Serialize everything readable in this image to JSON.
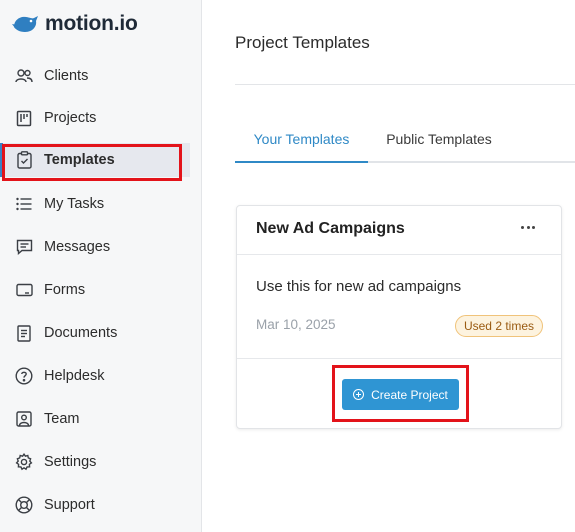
{
  "brand": {
    "name": "motion.io"
  },
  "sidebar": {
    "items": [
      {
        "label": "Clients",
        "icon": "clients-icon"
      },
      {
        "label": "Projects",
        "icon": "projects-icon"
      },
      {
        "label": "Templates",
        "icon": "templates-icon",
        "active": true
      },
      {
        "label": "My Tasks",
        "icon": "tasks-icon"
      },
      {
        "label": "Messages",
        "icon": "messages-icon"
      },
      {
        "label": "Forms",
        "icon": "forms-icon"
      },
      {
        "label": "Documents",
        "icon": "documents-icon"
      },
      {
        "label": "Helpdesk",
        "icon": "helpdesk-icon"
      },
      {
        "label": "Team",
        "icon": "team-icon"
      },
      {
        "label": "Settings",
        "icon": "gear-icon"
      },
      {
        "label": "Support",
        "icon": "support-icon"
      }
    ]
  },
  "main": {
    "title": "Project Templates",
    "tabs": [
      {
        "label": "Your Templates",
        "active": true
      },
      {
        "label": "Public Templates",
        "active": false
      }
    ],
    "card": {
      "title": "New Ad Campaigns",
      "description": "Use this for new ad campaigns",
      "date": "Mar 10, 2025",
      "usage": "Used 2 times",
      "button_label": "Create Project"
    }
  },
  "colors": {
    "accent": "#2f89c6",
    "button": "#2f95d3",
    "highlight": "#e3131a",
    "badge_bg": "#fdf3df",
    "badge_text": "#9a5b12"
  }
}
